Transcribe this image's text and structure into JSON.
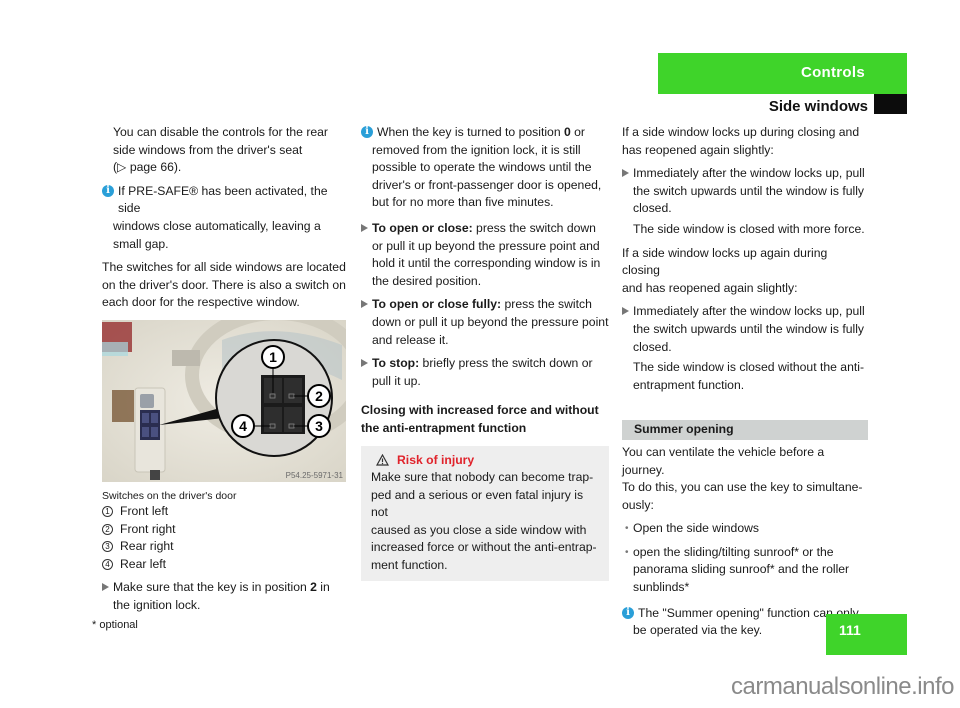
{
  "header": {
    "chapter": "Controls",
    "section": "Side windows",
    "accent_color": "#3fd42a"
  },
  "column1": {
    "intro_lines": [
      "You can disable the controls for the rear",
      "side windows from the driver's seat",
      "(▷ page 66)."
    ],
    "info_presafe": {
      "icon": "info-icon",
      "line1": "If PRE-SAFE® has been activated, the side",
      "line2": "windows close automatically, leaving a",
      "line3": "small gap."
    },
    "switches_text": [
      "The switches for all side windows are located",
      "on the driver's door. There is also a switch on",
      "each door for the respective window."
    ],
    "figure": {
      "code": "P54.25-5971-31",
      "callouts": [
        "1",
        "2",
        "3",
        "4"
      ]
    },
    "caption": "Switches on the driver's door",
    "legend": [
      {
        "num": "1",
        "label": "Front left"
      },
      {
        "num": "2",
        "label": "Front right"
      },
      {
        "num": "3",
        "label": "Rear right"
      },
      {
        "num": "4",
        "label": "Rear left"
      }
    ],
    "step": {
      "pre": "Make sure that the key is in position ",
      "bold": "2",
      "post": " in",
      "line2": "the ignition lock."
    }
  },
  "column2": {
    "info_key": {
      "line1_pre": "When the key is turned to position ",
      "line1_bold": "0",
      "line1_post": " or",
      "lines": [
        "removed from the ignition lock, it is still",
        "possible to operate the windows until the",
        "driver's or front-passenger door is opened,",
        "but for no more than five minutes."
      ]
    },
    "steps": [
      {
        "bold": "To open or close:",
        "text": " press the switch down",
        "lines": [
          "or pull it up beyond the pressure point and",
          "hold it until the corresponding window is in",
          "the desired position."
        ]
      },
      {
        "bold": "To open or close fully:",
        "text": " press the switch",
        "lines": [
          "down or pull it up beyond the pressure point",
          "and release it."
        ]
      },
      {
        "bold": "To stop:",
        "text": " briefly press the switch down or",
        "lines": [
          "pull it up."
        ]
      }
    ],
    "subheading": [
      "Closing with increased force and without",
      "the anti-entrapment function"
    ],
    "warning": {
      "title": "Risk of injury",
      "lines": [
        "Make sure that nobody can become trap-",
        "ped and a serious or even fatal injury is not",
        "caused as you close a side window with",
        "increased force or without the anti-entrap-",
        "ment function."
      ],
      "color": "#e0232b"
    }
  },
  "column3": {
    "lockup1": [
      "If a side window locks up during closing and",
      "has reopened again slightly:"
    ],
    "step1": [
      "Immediately after the window locks up, pull",
      "the switch upwards until the window is fully",
      "closed."
    ],
    "result1": "The side window is closed with more force.",
    "lockup2": [
      "If a side window locks up again during closing",
      "and has reopened again slightly:"
    ],
    "step2": [
      "Immediately after the window locks up, pull",
      "the switch upwards until the window is fully",
      "closed."
    ],
    "result2": [
      "The side window is closed without the anti-",
      "entrapment function."
    ],
    "summer": {
      "heading": "Summer opening",
      "intro": [
        "You can ventilate the vehicle before a journey.",
        "To do this, you can use the key to simultane-",
        "ously:"
      ],
      "bullets": [
        [
          "Open the side windows"
        ],
        [
          "open the sliding/tilting sunroof* or the",
          "panorama sliding sunroof* and the roller",
          "sunblinds*"
        ]
      ],
      "info": [
        "The \"Summer opening\" function can only",
        "be operated via the key."
      ]
    }
  },
  "footer": {
    "footnote": "* optional",
    "page_number": "111",
    "watermark": "carmanualsonline.info"
  }
}
